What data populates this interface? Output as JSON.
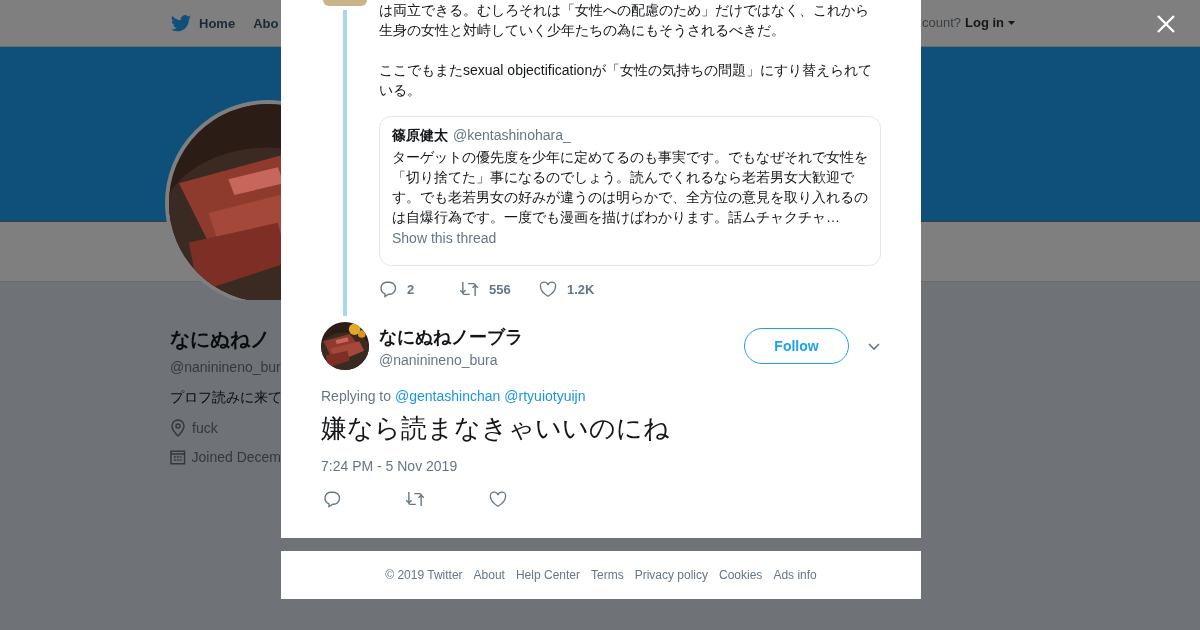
{
  "nav": {
    "home": "Home",
    "about": "Abo",
    "account_prompt": "count?",
    "login": "Log in"
  },
  "profile": {
    "name": "なにぬねノ",
    "handle": "@naninineno_bur",
    "bio": "プロフ読みに来て",
    "location": "fuck",
    "joined": "Joined Decem"
  },
  "parent_tweet": {
    "paragraphs": [
      "は両立できる。むしろそれは「女性への配慮のため」だけではなく、これから生身の女性と対峙していく少年たちの為にもそうされるべきだ。",
      "ここでもまたsexual objectificationが「女性の気持ちの問題」にすり替えられている。"
    ],
    "quote": {
      "name": "篠原健太",
      "handle": "@kentashinohara_",
      "text": "ターゲットの優先度を少年に定めてるのも事実です。でもなぜそれで女性を「切り捨てた」事になるのでしょう。読んでくれるなら老若男女大歓迎です。でも老若男女の好みが違うのは明らかで、全方位の意見を取り入れるのは自爆行為です。一度でも漫画を描けばわかります。話ムチャクチャ…",
      "thread_link": "Show this thread"
    },
    "stats": {
      "replies": "2",
      "retweets": "556",
      "likes": "1.2K"
    }
  },
  "tweet": {
    "name": "なにぬねノーブラ",
    "handle": "@naninineno_bura",
    "follow": "Follow",
    "replying_label": "Replying to",
    "replying_to": [
      "@gentashinchan",
      "@rtyuiotyuijn"
    ],
    "text": "嫌なら読まなきゃいいのにね",
    "timestamp": "7:24 PM - 5 Nov 2019"
  },
  "footer": [
    "© 2019 Twitter",
    "About",
    "Help Center",
    "Terms",
    "Privacy policy",
    "Cookies",
    "Ads info"
  ]
}
